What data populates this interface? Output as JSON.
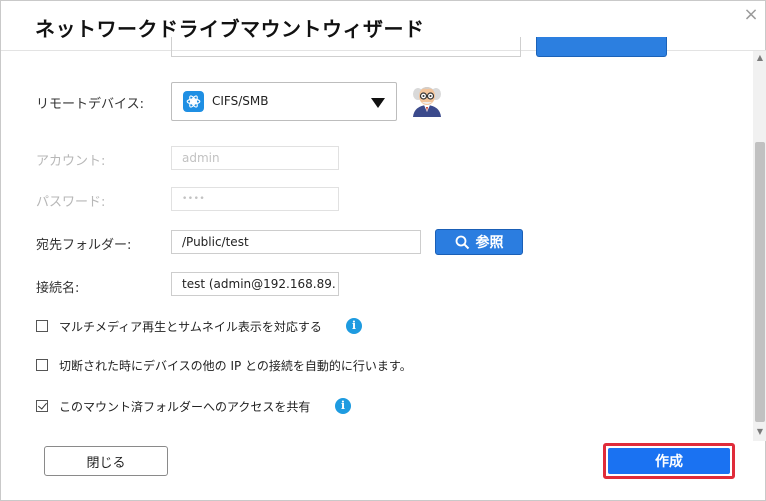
{
  "dialog": {
    "title": "ネットワークドライブマウントウィザード",
    "close_glyph": "×"
  },
  "form": {
    "remote_device": {
      "label": "リモートデバイス:",
      "selected": "CIFS/SMB",
      "selected_icon": "network-protocol-icon"
    },
    "account": {
      "label": "アカウント:",
      "value": "admin"
    },
    "password": {
      "label": "パスワード:",
      "value": "••••"
    },
    "destination": {
      "label": "宛先フォルダー:",
      "value": "/Public/test",
      "browse_label": "参照"
    },
    "connection_name": {
      "label": "接続名:",
      "value": "test (admin@192.168.89."
    }
  },
  "options": [
    {
      "label": "マルチメディア再生とサムネイル表示を対応する",
      "checked": false,
      "info": true
    },
    {
      "label": "切断された時にデバイスの他の IP との接続を自動的に行います。",
      "checked": false,
      "info": false
    },
    {
      "label": "このマウント済フォルダーへのアクセスを共有",
      "checked": true,
      "info": true
    }
  ],
  "info_glyph": "i",
  "footer": {
    "close_label": "閉じる",
    "create_label": "作成"
  },
  "colors": {
    "primary": "#1a72f2",
    "browse": "#2b7de0",
    "highlight": "#e02c3a",
    "info": "#1e9be0"
  }
}
